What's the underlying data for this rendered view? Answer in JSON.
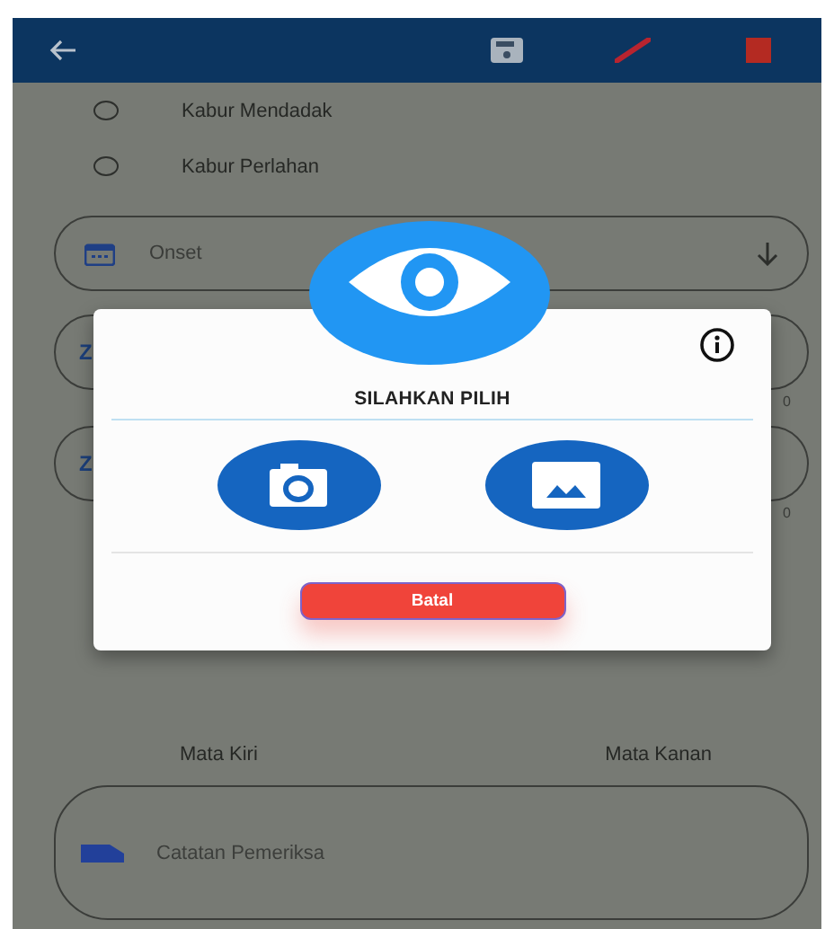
{
  "app_bar": {
    "actions": [
      {
        "kind": "save"
      },
      {
        "kind": "pen"
      },
      {
        "kind": "square"
      }
    ]
  },
  "radio_options": [
    {
      "label": "Kabur Mendadak",
      "selected": false
    },
    {
      "label": "Kabur Perlahan",
      "selected": false
    }
  ],
  "fields": [
    {
      "kind": "date",
      "label": "Onset"
    },
    {
      "kind": "text",
      "label": "Z",
      "counter": "0"
    },
    {
      "kind": "text",
      "label": "Z",
      "counter": "0"
    }
  ],
  "eye_labels": [
    "Mata Kiri",
    "Mata Kanan"
  ],
  "notes": {
    "placeholder": "Catatan Pemeriksa"
  },
  "dialog": {
    "title": "SILAHKAN PILIH",
    "options": [
      {
        "kind": "camera"
      },
      {
        "kind": "gallery"
      }
    ],
    "cancel": "Batal"
  }
}
